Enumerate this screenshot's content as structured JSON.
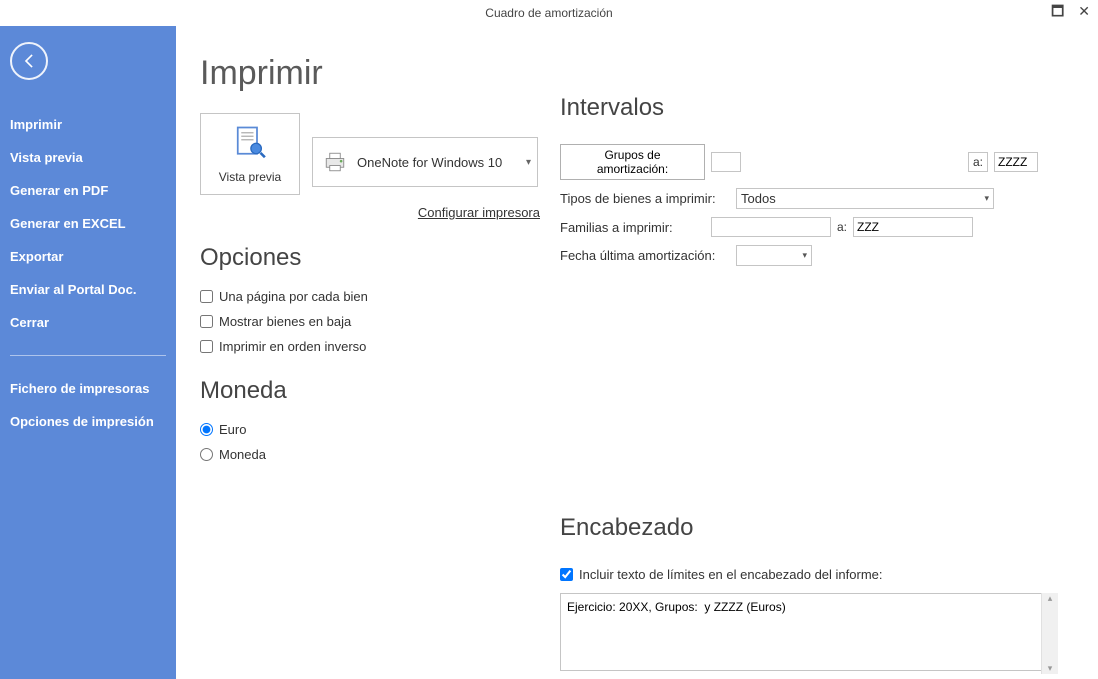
{
  "window": {
    "title": "Cuadro de amortización"
  },
  "sidebar": {
    "items": [
      "Imprimir",
      "Vista previa",
      "Generar en PDF",
      "Generar en EXCEL",
      "Exportar",
      "Enviar al Portal Doc.",
      "Cerrar"
    ],
    "items2": [
      "Fichero de impresoras",
      "Opciones de impresión"
    ]
  },
  "main": {
    "title": "Imprimir",
    "preview_btn": "Vista previa",
    "printer_name": "OneNote for Windows 10",
    "config_link": "Configurar impresora",
    "options_heading": "Opciones",
    "options": [
      "Una página por cada bien",
      "Mostrar bienes en baja",
      "Imprimir en orden inverso"
    ],
    "currency_heading": "Moneda",
    "currency_options": [
      "Euro",
      "Moneda"
    ],
    "currency_selected": "Euro"
  },
  "intervals": {
    "heading": "Intervalos",
    "groups_btn": "Grupos de amortización:",
    "groups_from": "",
    "a_label": "a:",
    "groups_to": "ZZZZ",
    "tipos_label": "Tipos de bienes a imprimir:",
    "tipos_value": "Todos",
    "familias_label": "Familias a imprimir:",
    "familias_from": "",
    "a_label2": "a:",
    "familias_to": "ZZZ",
    "fecha_label": "Fecha última amortización:",
    "fecha_value": ""
  },
  "header": {
    "heading": "Encabezado",
    "checkbox_label": "Incluir texto de límites en el encabezado del informe:",
    "text": "Ejercicio: 20XX, Grupos:  y ZZZZ (Euros)"
  }
}
